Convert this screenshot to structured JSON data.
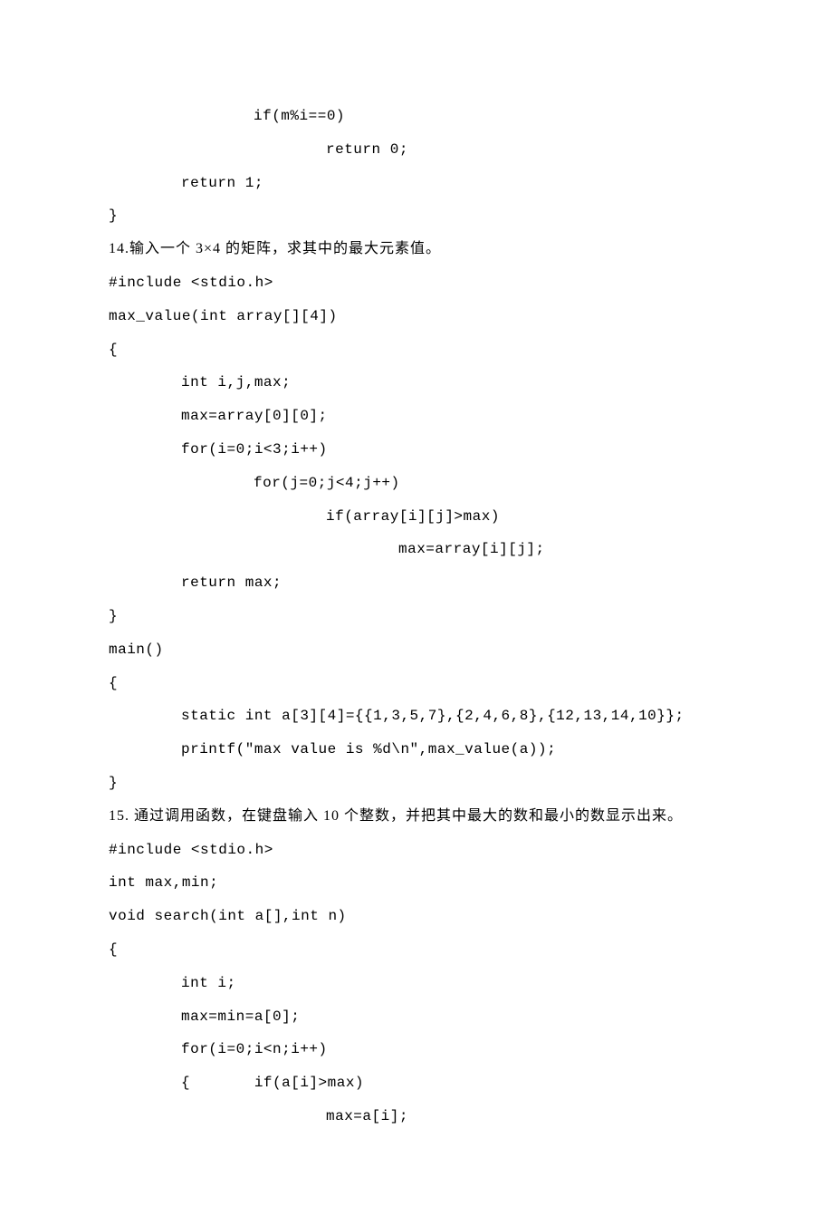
{
  "lines": [
    {
      "cls": "line code-font indent-2",
      "text": "if(m%i==0)"
    },
    {
      "cls": "line code-font indent-3",
      "text": "return 0;"
    },
    {
      "cls": "line code-font indent-1",
      "text": "return 1;"
    },
    {
      "cls": "line code-font",
      "text": "}"
    },
    {
      "cls": "line desc",
      "text": "14.输入一个 3×4 的矩阵，求其中的最大元素值。"
    },
    {
      "cls": "line code-font",
      "text": "#include <stdio.h>"
    },
    {
      "cls": "line code-font",
      "text": "max_value(int array[][4])"
    },
    {
      "cls": "line code-font",
      "text": "{"
    },
    {
      "cls": "line code-font indent-1",
      "text": "int i,j,max;"
    },
    {
      "cls": "line code-font indent-1",
      "text": "max=array[0][0];"
    },
    {
      "cls": "line code-font indent-1",
      "text": "for(i=0;i<3;i++)"
    },
    {
      "cls": "line code-font indent-2",
      "text": "for(j=0;j<4;j++)"
    },
    {
      "cls": "line code-font indent-3",
      "text": "if(array[i][j]>max)"
    },
    {
      "cls": "line code-font indent-4",
      "text": "max=array[i][j];"
    },
    {
      "cls": "line code-font indent-1",
      "text": "return max;"
    },
    {
      "cls": "line code-font",
      "text": "}"
    },
    {
      "cls": "line code-font",
      "text": "main()"
    },
    {
      "cls": "line code-font",
      "text": "{"
    },
    {
      "cls": "line code-font indent-1",
      "text": "static int a[3][4]={{1,3,5,7},{2,4,6,8},{12,13,14,10}};"
    },
    {
      "cls": "line code-font indent-1",
      "text": "printf(\"max value is %d\\n\",max_value(a));"
    },
    {
      "cls": "line code-font",
      "text": "}"
    },
    {
      "cls": "line desc",
      "text": "15. 通过调用函数，在键盘输入 10 个整数，并把其中最大的数和最小的数显示出来。"
    },
    {
      "cls": "line code-font",
      "text": "#include <stdio.h>"
    },
    {
      "cls": "line code-font",
      "text": "int max,min;"
    },
    {
      "cls": "line code-font",
      "text": "void search(int a[],int n)"
    },
    {
      "cls": "line code-font",
      "text": "{"
    },
    {
      "cls": "line code-font indent-1",
      "text": "int i;"
    },
    {
      "cls": "line code-font indent-1",
      "text": "max=min=a[0];"
    },
    {
      "cls": "line code-font indent-1",
      "text": "for(i=0;i<n;i++)"
    },
    {
      "cls": "line code-font indent-1",
      "text": "{       if(a[i]>max)"
    },
    {
      "cls": "line code-font indent-3",
      "text": "max=a[i];"
    }
  ]
}
